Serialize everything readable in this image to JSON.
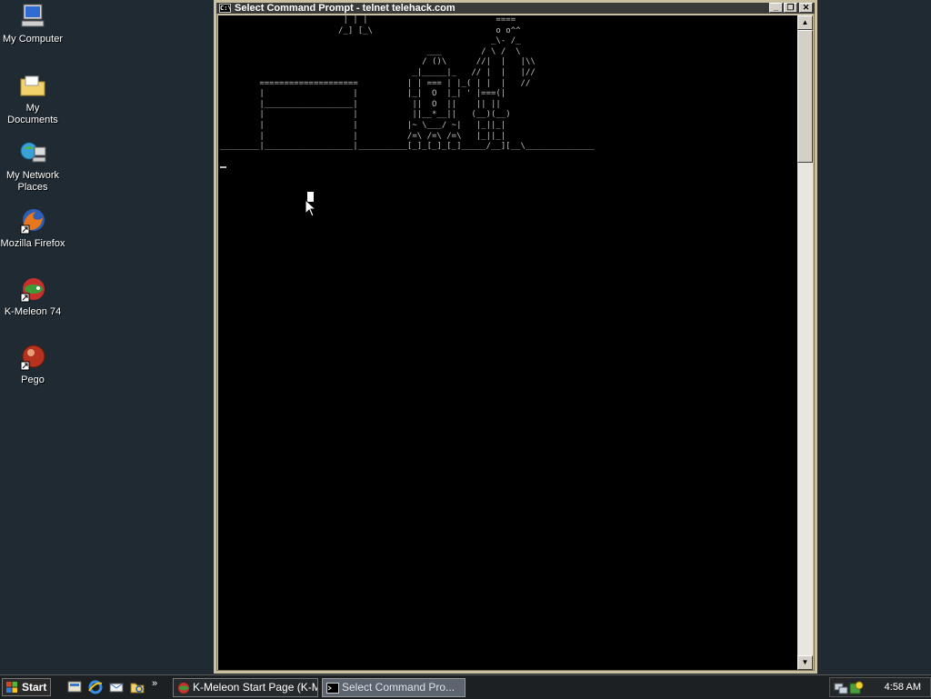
{
  "desktop": {
    "icons": [
      {
        "label": "My Computer",
        "icon": "computer-icon"
      },
      {
        "label": "My Documents",
        "icon": "folder-icon"
      },
      {
        "label": "My Network Places",
        "icon": "network-icon"
      },
      {
        "label": "Mozilla Firefox",
        "icon": "firefox-icon"
      },
      {
        "label": "K-Meleon 74",
        "icon": "kmeleon-icon"
      },
      {
        "label": "Pego",
        "icon": "pego-icon"
      }
    ]
  },
  "window": {
    "title": "Select Command Prompt - telnet telehack.com",
    "minimize": "_",
    "restore": "❐",
    "close": "✕",
    "console_text": "                         | | |                          ====\n                        /_] [_\\                         o o^^\n                                                       _\\- /_\n                                          ___        / \\ /  \\\n                                         / ()\\      //|  |   |\\\\\n                                       _|_____|_   // |  |   |//\n        ====================          | | === | |_( | |  |   //\n        |                  |          |_|  O  |_| ' |===(|\n        |__________________|           ||  O  ||    || ||\n        |                  |           ||__*__||   (__)(__)\n        |                  |          |~ \\___/ ~|   |_||_|\n        |                  |          /=\\ /=\\ /=\\   |_||_|\n________|__________________|__________[_]_[_]_[_]_____/__][__\\______________"
  },
  "taskbar": {
    "start_label": "Start",
    "more": "»",
    "tasks": [
      {
        "label": "K-Meleon Start Page (K-M...",
        "active": false
      },
      {
        "label": "Select Command Pro...",
        "active": true
      }
    ],
    "clock": "4:58 AM"
  }
}
